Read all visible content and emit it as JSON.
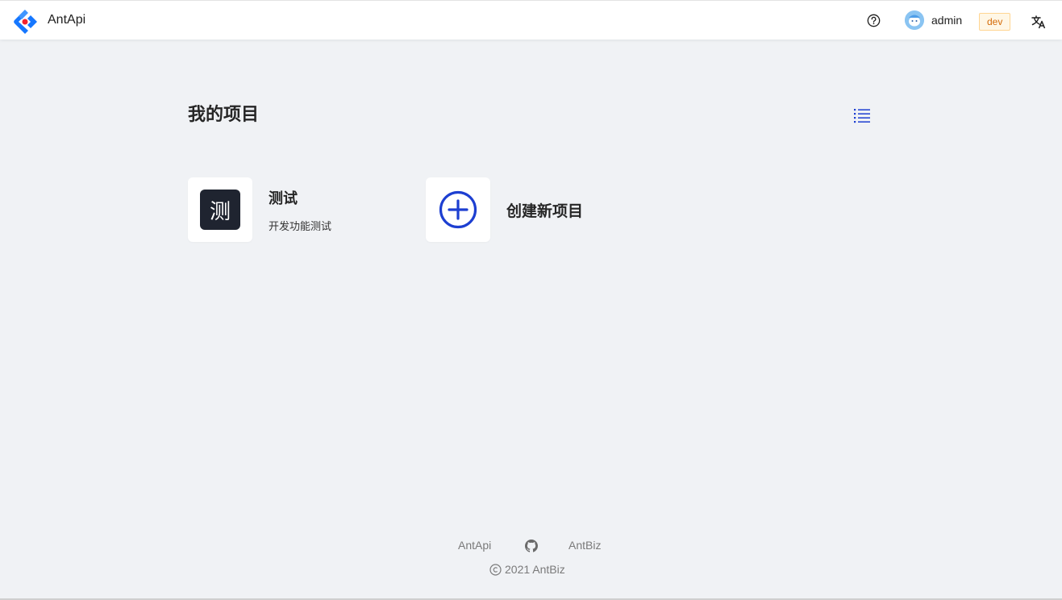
{
  "header": {
    "app_title": "AntApi",
    "username": "admin",
    "env_tag": "dev"
  },
  "main": {
    "page_title": "我的项目",
    "projects": [
      {
        "icon_letter": "测",
        "name": "测试",
        "description": "开发功能测试"
      }
    ],
    "create_label": "创建新项目"
  },
  "footer": {
    "links": [
      "AntApi",
      "AntBiz"
    ],
    "copyright": "2021 AntBiz"
  },
  "colors": {
    "accent": "#1d3fd1",
    "tag_text": "#d46b08",
    "background": "#f0f2f5"
  },
  "icons": [
    "logo-icon",
    "help-icon",
    "avatar",
    "translate-icon",
    "list-view-icon",
    "plus-circle-icon",
    "github-icon",
    "copyright-icon"
  ]
}
